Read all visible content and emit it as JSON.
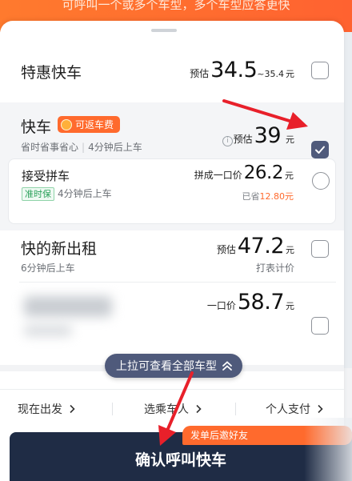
{
  "banner": {
    "text": "可呼叫一个或多个车型，多个车型应答更快"
  },
  "rides": [
    {
      "title": "特惠快车",
      "price_prefix": "预估",
      "price": "34.5",
      "price_range": "~35.4",
      "unit": "元",
      "checked": false
    },
    {
      "title": "快车",
      "badge": "可返车费",
      "sub_a": "省时省事省心",
      "sub_b": "4分钟后上车",
      "info_icon": "i",
      "price_prefix": "预估",
      "price": "39",
      "unit": "元",
      "checked": true
    },
    {
      "title": "接受拼车",
      "tag": "准时保",
      "sub": "4分钟后上车",
      "price_prefix": "拼成一口价",
      "price": "26.2",
      "unit": "元",
      "saved_prefix": "已省",
      "saved_value": "12.80元",
      "checked": false
    },
    {
      "title": "快的新出租",
      "sub": "6分钟后上车",
      "price_prefix": "预估",
      "price": "47.2",
      "unit": "元",
      "note": "打表计价",
      "checked": false
    },
    {
      "price_prefix": "一口价",
      "price": "58.7",
      "unit": "元",
      "checked": false
    }
  ],
  "pull_hint": "上拉可查看全部车型",
  "options": {
    "depart": "现在出发",
    "rider": "选乘车人",
    "pay": "个人支付"
  },
  "confirm": {
    "label": "确认呼叫快车",
    "badge": "发单后邀好友"
  },
  "colors": {
    "accent": "#ff6a2d",
    "primary_dark": "#1f2c45",
    "checkbox_checked": "#4f5a7b",
    "arrow_red": "#e8202a"
  },
  "icons": {
    "check": "check-icon",
    "chevron_up": "chevron-up-icon",
    "chevron_right": "chevron-right-icon",
    "info": "info-icon",
    "coin": "coin-icon"
  }
}
